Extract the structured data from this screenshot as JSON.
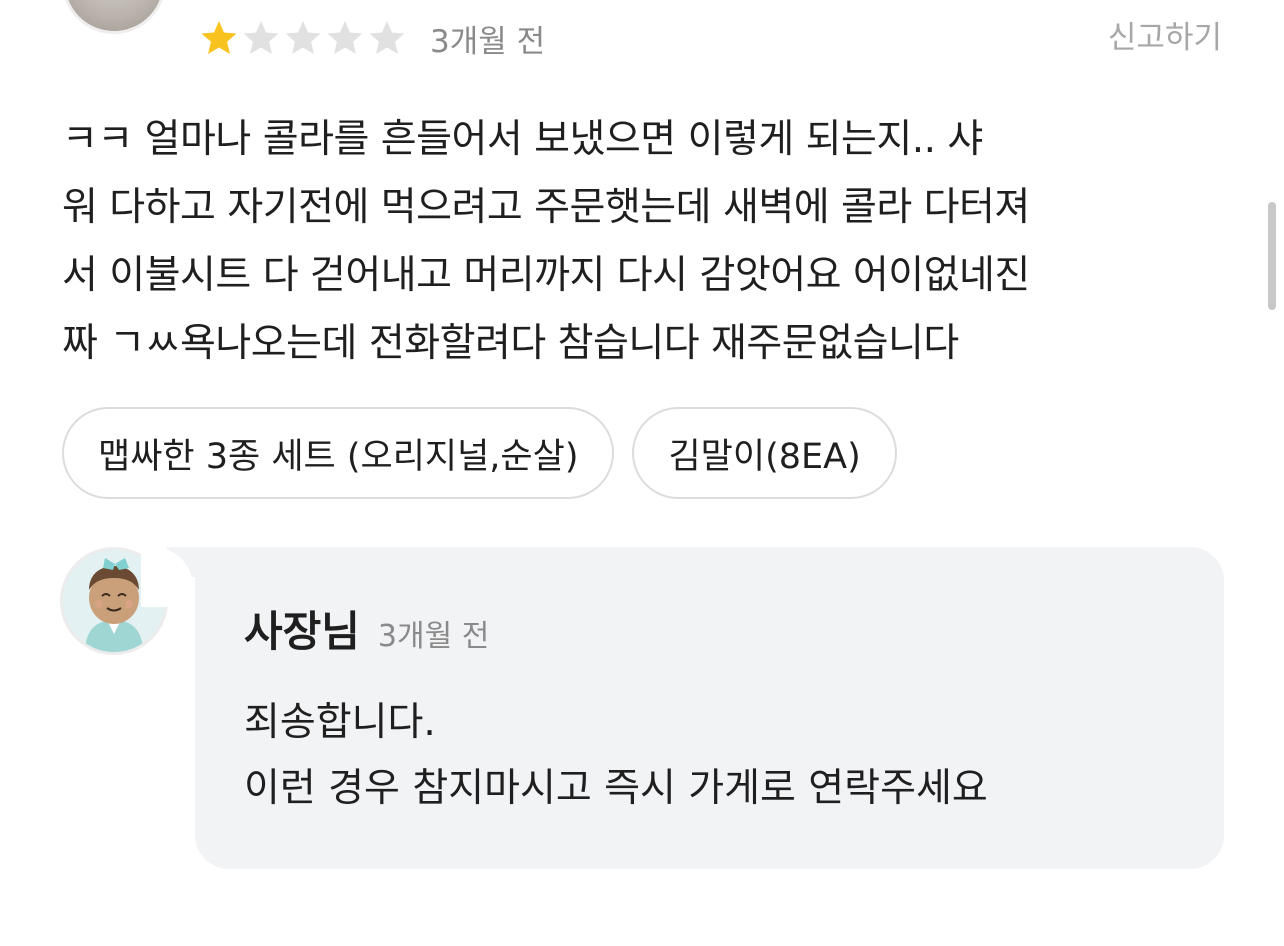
{
  "review": {
    "rating": 1,
    "max_rating": 5,
    "date": "3개월 전",
    "report_label": "신고하기",
    "text": "ㅋㅋ 얼마나 콜라를 흔들어서 보냈으면 이렇게 되는지.. 샤\n워 다하고 자기전에 먹으려고 주문햇는데 새벽에 콜라 다터져\n서 이불시트 다 걷어내고 머리까지 다시 감앗어요 어이없네진\n짜 ㄱㅆ욕나오는데 전화할려다 참습니다  재주문없습니다",
    "menu_items": [
      {
        "label": "맵싸한 3종 세트 (오리지널,순살)"
      },
      {
        "label": "김말이(8EA)"
      }
    ]
  },
  "reply": {
    "author": "사장님",
    "date": "3개월 전",
    "text": "죄송합니다.\n이런 경우 참지마시고 즉시 가게로 연락주세요"
  },
  "colors": {
    "star_filled": "#F9C31F",
    "star_empty": "#E1E1E1",
    "bubble_bg": "#F2F3F5",
    "muted_text": "#8A8A8A"
  },
  "icons": {
    "star": "star-icon",
    "reviewer_avatar": "reviewer-avatar",
    "owner_avatar": "owner-avatar"
  }
}
